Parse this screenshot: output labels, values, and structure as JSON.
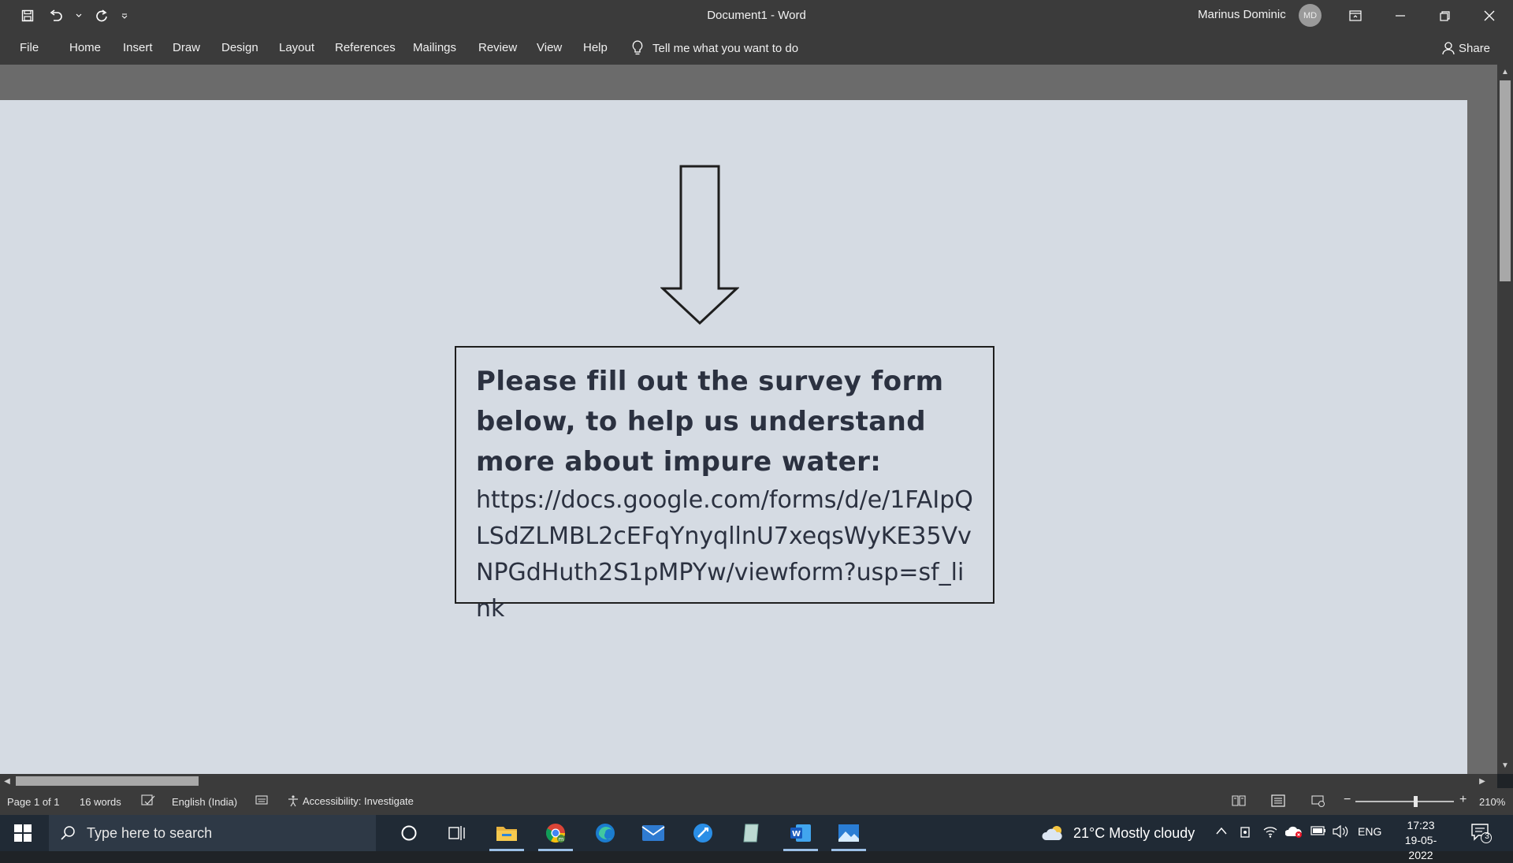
{
  "window": {
    "title": "Document1  -  Word",
    "user_name": "Marinus Dominic",
    "user_initials": "MD"
  },
  "ribbon": {
    "tabs": [
      "File",
      "Home",
      "Insert",
      "Draw",
      "Design",
      "Layout",
      "References",
      "Mailings",
      "Review",
      "View",
      "Help"
    ],
    "tell_me": "Tell me what you want to do",
    "share": "Share"
  },
  "document": {
    "heading": "Please fill out the survey form below, to help us understand more about impure water:",
    "link": "https://docs.google.com/forms/d/e/1FAIpQLSdZLMBL2cEFqYnyqllnU7xeqsWyKE35VvNPGdHuth2S1pMPYw/viewform?usp=sf_link"
  },
  "status": {
    "page": "Page 1 of 1",
    "words": "16 words",
    "language": "English (India)",
    "accessibility": "Accessibility: Investigate",
    "zoom": "210%"
  },
  "taskbar": {
    "search_placeholder": "Type here to search",
    "weather": "21°C  Mostly cloudy",
    "lang": "ENG",
    "time": "17:23",
    "date": "19-05-2022",
    "notifications": "3"
  },
  "colors": {
    "title_bar": "#3b3b3b",
    "page": "#d5dbe3",
    "canvas": "#6b6b6b",
    "taskbar": "#202a35",
    "text": "#2b3140"
  }
}
